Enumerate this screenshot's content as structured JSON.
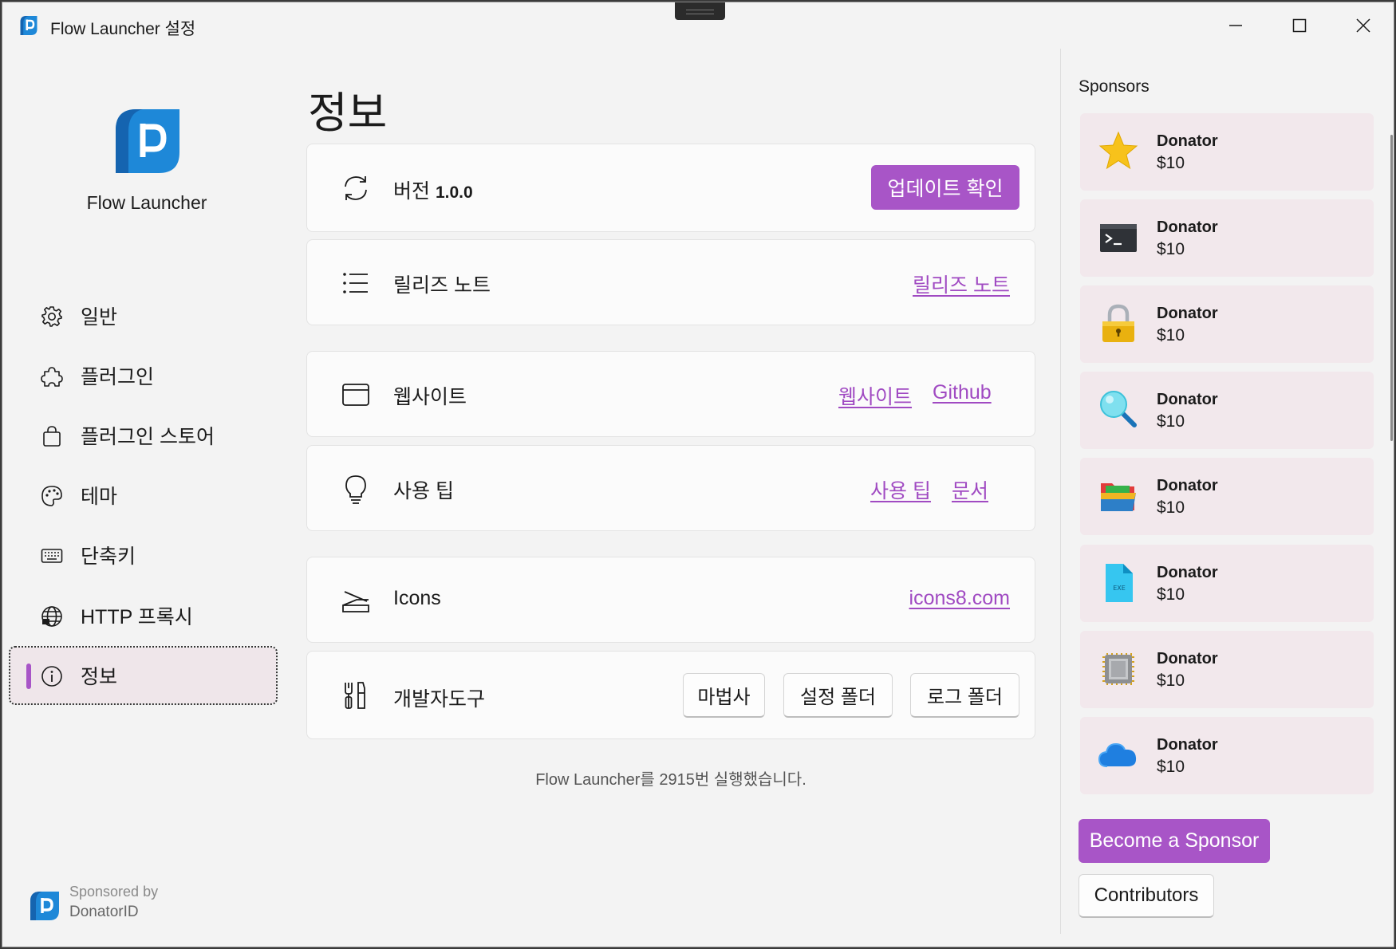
{
  "window": {
    "title": "Flow Launcher 설정"
  },
  "sidebar": {
    "brand": "Flow Launcher",
    "items": [
      {
        "label": "일반",
        "icon": "gear-icon"
      },
      {
        "label": "플러그인",
        "icon": "puzzle-icon"
      },
      {
        "label": "플러그인 스토어",
        "icon": "shopping-bag-icon"
      },
      {
        "label": "테마",
        "icon": "palette-icon"
      },
      {
        "label": "단축키",
        "icon": "keyboard-icon"
      },
      {
        "label": "HTTP 프록시",
        "icon": "globe-icon"
      },
      {
        "label": "정보",
        "icon": "info-icon",
        "selected": true
      }
    ],
    "sponsor_footer": {
      "by": "Sponsored by",
      "name": "DonatorID"
    }
  },
  "main": {
    "title": "정보",
    "version": {
      "label": "버전",
      "value": "1.0.0",
      "button": "업데이트 확인"
    },
    "release_notes": {
      "label": "릴리즈 노트",
      "link": "릴리즈 노트"
    },
    "website": {
      "label": "웹사이트",
      "links": [
        "웹사이트",
        "Github"
      ]
    },
    "tips": {
      "label": "사용 팁",
      "links": [
        "사용 팁",
        "문서"
      ]
    },
    "icons": {
      "label": "Icons",
      "link": "icons8.com"
    },
    "devtools": {
      "label": "개발자도구",
      "buttons": [
        "마법사",
        "설정 폴더",
        "로그 폴더"
      ]
    },
    "launch_count": "Flow Launcher를 2915번 실행했습니다."
  },
  "sponsors": {
    "title": "Sponsors",
    "items": [
      {
        "name": "Donator",
        "amount": "$10",
        "icon": "star-icon"
      },
      {
        "name": "Donator",
        "amount": "$10",
        "icon": "terminal-icon"
      },
      {
        "name": "Donator",
        "amount": "$10",
        "icon": "lock-icon"
      },
      {
        "name": "Donator",
        "amount": "$10",
        "icon": "magnifier-icon"
      },
      {
        "name": "Donator",
        "amount": "$10",
        "icon": "folder-icon"
      },
      {
        "name": "Donator",
        "amount": "$10",
        "icon": "exe-file-icon"
      },
      {
        "name": "Donator",
        "amount": "$10",
        "icon": "cpu-chip-icon"
      },
      {
        "name": "Donator",
        "amount": "$10",
        "icon": "cloud-icon"
      }
    ],
    "become_sponsor": "Become a Sponsor",
    "contributors": "Contributors"
  },
  "colors": {
    "accent": "#a855c7",
    "link": "#a04ac2",
    "logo": "#1e88d8",
    "sponsor_card": "#f2e8ec"
  }
}
